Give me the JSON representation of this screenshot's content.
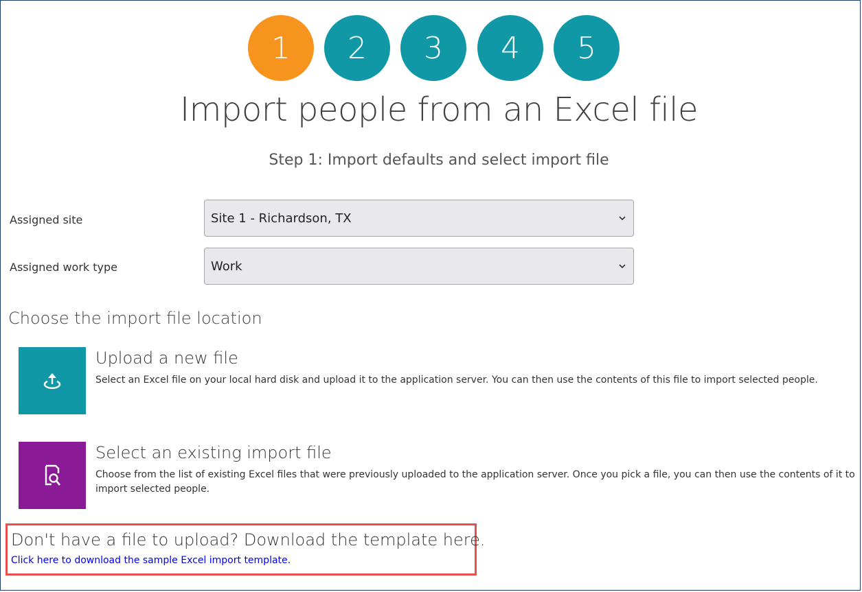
{
  "wizard": {
    "steps": [
      {
        "label": "1",
        "state": "active"
      },
      {
        "label": "2",
        "state": "inactive"
      },
      {
        "label": "3",
        "state": "inactive"
      },
      {
        "label": "4",
        "state": "inactive"
      },
      {
        "label": "5",
        "state": "inactive"
      }
    ],
    "active_color": "#f7941d",
    "inactive_color": "#1198a6"
  },
  "page": {
    "title": "Import people from an Excel file",
    "subtitle": "Step 1: Import defaults and select import file"
  },
  "form": {
    "assigned_site": {
      "label": "Assigned site",
      "value": "Site 1 - Richardson, TX"
    },
    "assigned_work_type": {
      "label": "Assigned work type",
      "value": "Work"
    }
  },
  "file_location": {
    "heading": "Choose the import file location",
    "options": [
      {
        "icon": "upload-icon",
        "color": "#1198a6",
        "title": "Upload a new file",
        "description": "Select an Excel file on your local hard disk and upload it to the application server. You can then use the contents of this file to import selected people."
      },
      {
        "icon": "search-file-icon",
        "color": "#8b1a96",
        "title": "Select an existing import file",
        "description": "Choose from the list of existing Excel files that were previously uploaded to the application server. Once you pick a file, you can then use the contents of it to import selected people."
      }
    ]
  },
  "template": {
    "heading": "Don't have a file to upload? Download the template here.",
    "link": "Click here to download the sample Excel import template.",
    "highlight_color": "#e8504f"
  }
}
